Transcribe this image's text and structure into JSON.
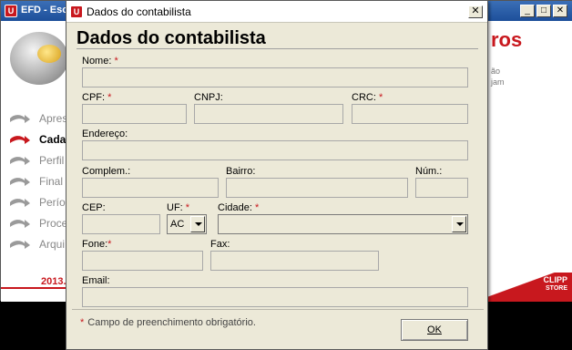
{
  "background_window": {
    "title": "EFD - Esc",
    "app_icon_text": "U",
    "controls": {
      "minimize": "_",
      "restore": "□",
      "close": "✕"
    },
    "nav": [
      {
        "label": "Apres",
        "active": false
      },
      {
        "label": "Cadas",
        "active": true
      },
      {
        "label": "Perfil",
        "active": false
      },
      {
        "label": "Final",
        "active": false
      },
      {
        "label": "Perío",
        "active": false
      },
      {
        "label": "Proce",
        "active": false
      },
      {
        "label": "Arqui",
        "active": false
      }
    ],
    "version_text": "2013.",
    "right_heading": "ros",
    "right_lines": [
      "ão",
      "jam"
    ],
    "brand_lines": [
      "CLIPP",
      "STORE"
    ]
  },
  "dialog": {
    "title": "Dados do contabilista",
    "heading": "Dados do contabilista",
    "close_label": "✕",
    "required_marker": "*",
    "fields": {
      "nome": {
        "label": "Nome:",
        "value": "",
        "required": true
      },
      "cpf": {
        "label": "CPF:",
        "value": "",
        "required": true
      },
      "cnpj": {
        "label": "CNPJ:",
        "value": "",
        "required": false
      },
      "crc": {
        "label": "CRC:",
        "value": "",
        "required": true
      },
      "endereco": {
        "label": "Endereço:",
        "value": "",
        "required": false
      },
      "complem": {
        "label": "Complem.:",
        "value": "",
        "required": false
      },
      "bairro": {
        "label": "Bairro:",
        "value": "",
        "required": false
      },
      "num": {
        "label": "Núm.:",
        "value": "",
        "required": false
      },
      "cep": {
        "label": "CEP:",
        "value": "",
        "required": false
      },
      "uf": {
        "label": "UF:",
        "value": "AC",
        "required": true
      },
      "cidade": {
        "label": "Cidade:",
        "value": "",
        "required": true
      },
      "fone": {
        "label": "Fone:",
        "value": "",
        "required": true
      },
      "fax": {
        "label": "Fax:",
        "value": "",
        "required": false
      },
      "email": {
        "label": "Email:",
        "value": "",
        "required": false
      }
    },
    "footnote": "Campo de preenchimento obrigatório.",
    "ok_label": "OK"
  },
  "colors": {
    "accent": "#c8181e",
    "titlebar": "#1d4f9a",
    "dialog_bg": "#ece9d8"
  }
}
